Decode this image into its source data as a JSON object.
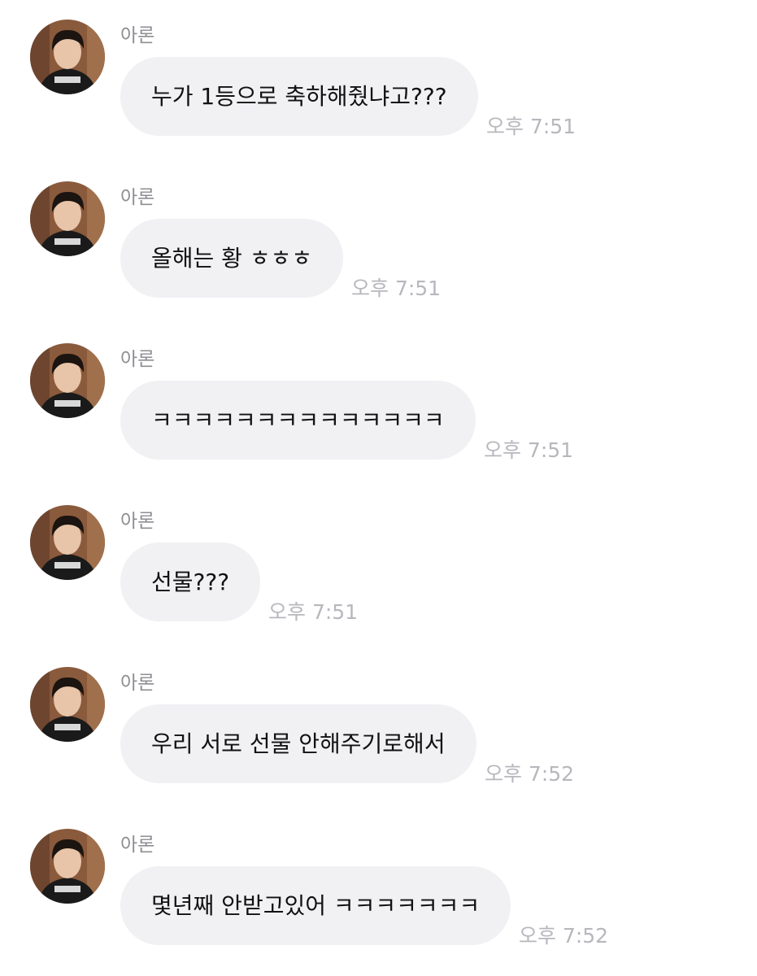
{
  "messages": [
    {
      "sender": "아론",
      "text": "누가 1등으로 축하해줬냐고???",
      "time": "오후 7:51"
    },
    {
      "sender": "아론",
      "text": "올해는 황 ㅎㅎㅎ",
      "time": "오후 7:51"
    },
    {
      "sender": "아론",
      "text": "ㅋㅋㅋㅋㅋㅋㅋㅋㅋㅋㅋㅋㅋㅋ",
      "time": "오후 7:51"
    },
    {
      "sender": "아론",
      "text": "선물???",
      "time": "오후 7:51"
    },
    {
      "sender": "아론",
      "text": "우리 서로 선물 안해주기로해서",
      "time": "오후 7:52"
    },
    {
      "sender": "아론",
      "text": "몇년째 안받고있어 ㅋㅋㅋㅋㅋㅋㅋ",
      "time": "오후 7:52"
    }
  ],
  "colors": {
    "bubble": "#f1f1f4",
    "sender": "#8e8e93",
    "time": "#b7b7bd",
    "text": "#111111"
  }
}
